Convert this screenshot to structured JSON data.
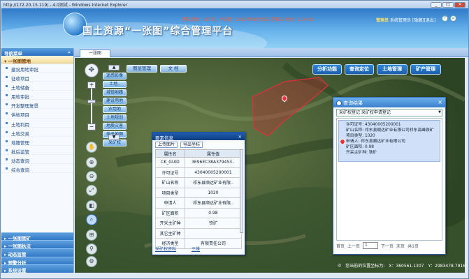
{
  "browser": {
    "title": "http://172.20.15.119/ - 4.0测试 - Windows Internet Explorer"
  },
  "header": {
    "title": "国土资源“一张图”综合管理平台",
    "status": "登陆次数：307次；今天是：2013年08月09日 星期五 时间：1:34:03",
    "user_role": "管理员",
    "user_name": "系统管理员",
    "hide_link": "[隐藏]",
    "exit_link": "[退出]"
  },
  "sidebar": {
    "header": "导航菜单",
    "collapse": "«",
    "open_group": "一张图管地",
    "items": [
      "建设用地审批",
      "征收项目",
      "土地储备",
      "用地审批",
      "开发整理复垦",
      "供地项目",
      "土地利用",
      "土地交易",
      "地籍管理",
      "批后监管",
      "动态查询",
      "综合查询"
    ],
    "groups": [
      "一张图管矿",
      "一张图执法",
      "动态监管",
      "预警分析",
      "系统设置"
    ]
  },
  "tabs": [
    {
      "label": "一张图"
    }
  ],
  "map": {
    "toolbar": {
      "layers": "图层管理",
      "doc": "文 档"
    },
    "actions": [
      "分析功能",
      "查询定位",
      "土地管理",
      "矿产管理"
    ],
    "layers": [
      "遥感影像",
      "土地..",
      "城镇地籍",
      "建设用地",
      "农用地",
      "土地规划",
      "地质灾害",
      "电子地图",
      "采矿权"
    ],
    "coords": {
      "label": "您当前的位置坐标为:",
      "x": "X：360561.1307",
      "y": "Y：2983478.7916"
    }
  },
  "property_panel": {
    "title": "要素信息",
    "close": "×",
    "buttons": [
      "上传图片",
      "导出坐标"
    ],
    "headers": [
      "属性名",
      "属性值"
    ],
    "rows": [
      [
        "CK_GUID",
        "3E96EC38A379453.."
      ],
      [
        "许可证号",
        "43040005200001"
      ],
      [
        "矿山名称",
        "祁东县顺达矿业有限.."
      ],
      [
        "项目类型",
        "1020"
      ],
      [
        "申请人",
        "祁东县顺达矿业有限.."
      ],
      [
        "矿区面积",
        "0.98"
      ],
      [
        "开采主矿种",
        "铁矿"
      ],
      [
        "其它主矿种",
        ""
      ],
      [
        "经济类型",
        "有限责任公司"
      ]
    ],
    "footer": [
      "采矿权资料",
      "三维"
    ]
  },
  "query_panel": {
    "title": "查询结果",
    "close": "×",
    "select_value": "采矿权登记 采矿权申请登记",
    "card": [
      "许可证号: 43040005200001",
      "矿山名称: 祁东县顺达矿业有限公司祁东高峰铁矿",
      "项目类型: 1020",
      "申请人: 祁东县顺达矿业有限公司",
      "矿区面积: 0.98",
      "开采主矿种: 铁矿"
    ],
    "nav": {
      "first": "首页",
      "prev": "上一页",
      "page": "1",
      "next": "下一页",
      "last": "末页",
      "total": "共1页"
    }
  }
}
